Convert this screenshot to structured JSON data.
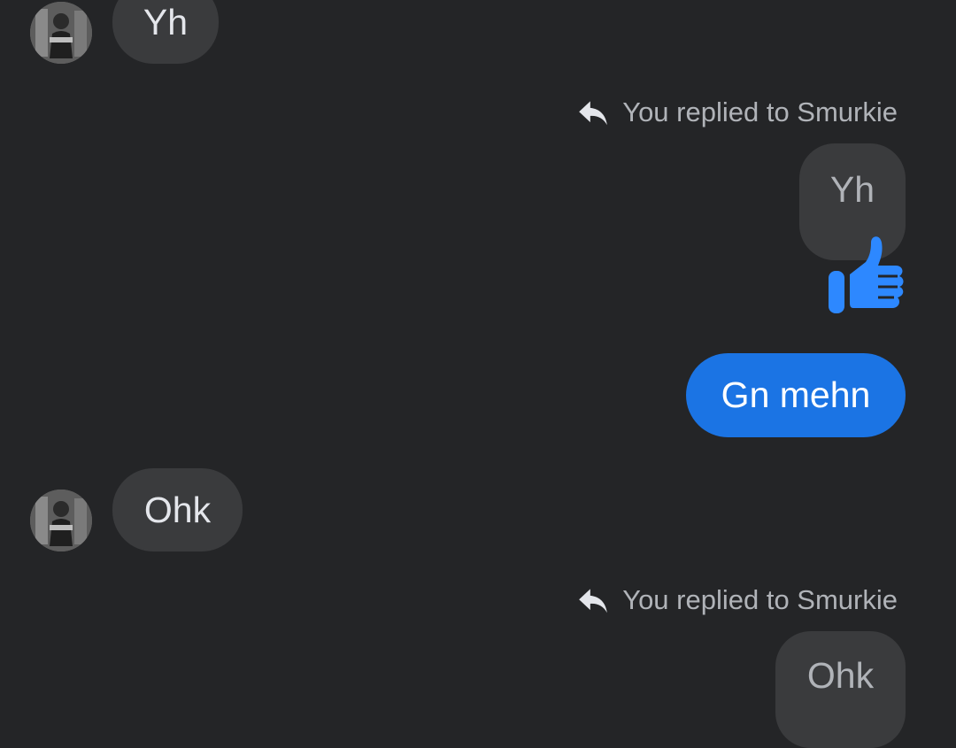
{
  "messages": [
    {
      "type": "incoming",
      "text": "Yh",
      "avatar_icon": "contact-avatar"
    },
    {
      "type": "reply_label",
      "text": "You replied to Smurkie",
      "icon": "reply-arrow-icon"
    },
    {
      "type": "quoted",
      "text": "Yh",
      "reaction_icon": "thumbs-up-icon"
    },
    {
      "type": "outgoing",
      "text": "Gn mehn"
    },
    {
      "type": "incoming",
      "text": "Ohk",
      "avatar_icon": "contact-avatar"
    },
    {
      "type": "reply_label",
      "text": "You replied to Smurkie",
      "icon": "reply-arrow-icon"
    },
    {
      "type": "quoted",
      "text": "Ohk"
    }
  ],
  "colors": {
    "background": "#242527",
    "incoming_bubble": "#3a3b3d",
    "outgoing_bubble": "#1b74e4",
    "reaction": "#2d88ff",
    "meta_text": "#b0b3b8"
  }
}
